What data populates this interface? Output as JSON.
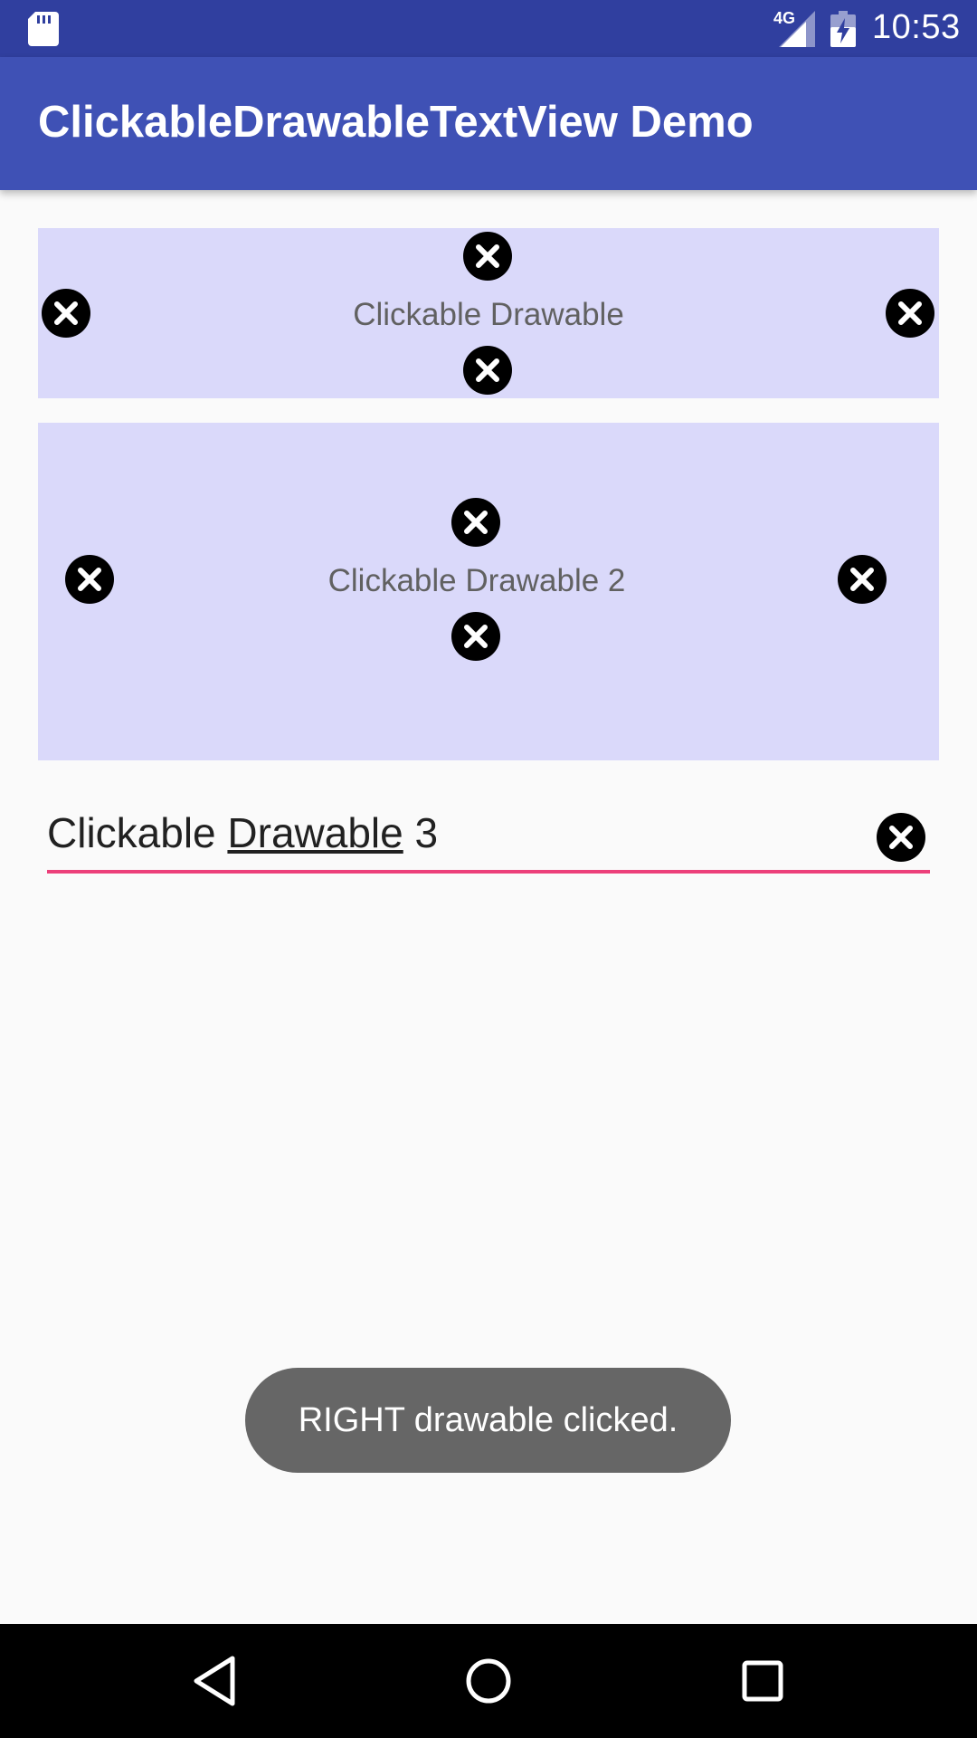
{
  "status_bar": {
    "time": "10:53",
    "network": "4G",
    "icons": [
      "sd-card-icon",
      "signal-icon",
      "battery-charging-icon"
    ]
  },
  "app_bar": {
    "title": "ClickableDrawableTextView Demo",
    "background": "#3f51b5"
  },
  "box1": {
    "label": "Clickable Drawable",
    "background": "#dad9fa",
    "drawables": [
      "top-close-icon",
      "left-close-icon",
      "right-close-icon",
      "bottom-close-icon"
    ]
  },
  "box2": {
    "label": "Clickable Drawable 2",
    "background": "#dad9fa",
    "drawables": [
      "top-close-icon",
      "left-close-icon",
      "right-close-icon",
      "bottom-close-icon"
    ]
  },
  "edit_field": {
    "text_before": "Clickable ",
    "text_underlined": "Drawable",
    "text_after": " 3",
    "underline_color": "#ec407a",
    "drawables": [
      "right-close-icon"
    ]
  },
  "toast": {
    "message": "RIGHT drawable clicked."
  },
  "nav_bar": {
    "buttons": [
      "back-icon",
      "home-icon",
      "recents-icon"
    ]
  }
}
